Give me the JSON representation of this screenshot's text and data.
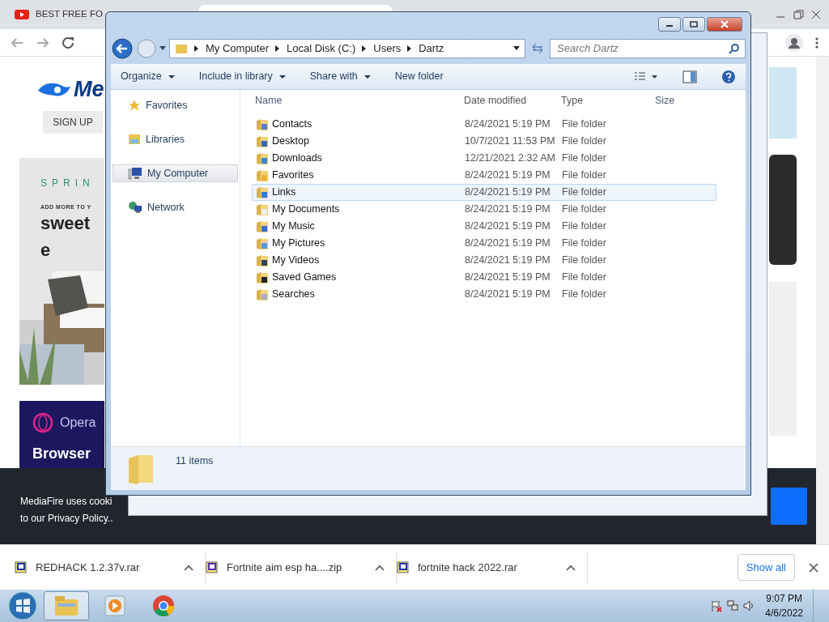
{
  "browser": {
    "tab_title": "BEST FREE FO",
    "page": {
      "logo_text": "Me",
      "sign_up": "SIGN UP",
      "ad_spring": "SPRIN",
      "ad_tagline": "ADD MORE TO Y",
      "ad_headline": "sweet e",
      "ad_brand": "Opera",
      "ad_title": "Browser",
      "cookie_lines": [
        "MediaFire uses cooki",
        "to our Privacy Policy.."
      ]
    }
  },
  "explorer": {
    "breadcrumb": [
      "My Computer",
      "Local Disk (C:)",
      "Users",
      "Dartz"
    ],
    "search": {
      "placeholder": "Search Dartz"
    },
    "toolbar": [
      {
        "label": "Organize",
        "dropdown": true
      },
      {
        "label": "Include in library",
        "dropdown": true
      },
      {
        "label": "Share with",
        "dropdown": true
      },
      {
        "label": "New folder",
        "dropdown": false
      }
    ],
    "nav": [
      {
        "label": "Favorites",
        "kind": "star",
        "selected": false
      },
      {
        "label": "Libraries",
        "kind": "library",
        "selected": false
      },
      {
        "label": "My Computer",
        "kind": "computer",
        "selected": true
      },
      {
        "label": "Network",
        "kind": "network",
        "selected": false
      }
    ],
    "columns": [
      "Name",
      "Date modified",
      "Type",
      "Size"
    ],
    "files": [
      {
        "name": "Contacts",
        "date": "8/24/2021 5:19 PM",
        "type": "File folder",
        "hovered": false
      },
      {
        "name": "Desktop",
        "date": "10/7/2021 11:53 PM",
        "type": "File folder",
        "hovered": false
      },
      {
        "name": "Downloads",
        "date": "12/21/2021 2:32 AM",
        "type": "File folder",
        "hovered": false
      },
      {
        "name": "Favorites",
        "date": "8/24/2021 5:19 PM",
        "type": "File folder",
        "hovered": false
      },
      {
        "name": "Links",
        "date": "8/24/2021 5:19 PM",
        "type": "File folder",
        "hovered": true
      },
      {
        "name": "My Documents",
        "date": "8/24/2021 5:19 PM",
        "type": "File folder",
        "hovered": false
      },
      {
        "name": "My Music",
        "date": "8/24/2021 5:19 PM",
        "type": "File folder",
        "hovered": false
      },
      {
        "name": "My Pictures",
        "date": "8/24/2021 5:19 PM",
        "type": "File folder",
        "hovered": false
      },
      {
        "name": "My Videos",
        "date": "8/24/2021 5:19 PM",
        "type": "File folder",
        "hovered": false
      },
      {
        "name": "Saved Games",
        "date": "8/24/2021 5:19 PM",
        "type": "File folder",
        "hovered": false
      },
      {
        "name": "Searches",
        "date": "8/24/2021 5:19 PM",
        "type": "File folder",
        "hovered": false
      }
    ],
    "status": "11 items"
  },
  "downloads": {
    "items": [
      {
        "name": "REDHACK 1.2.37v.rar",
        "kind": "rar"
      },
      {
        "name": "Fortnite aim esp ha....zip",
        "kind": "zip"
      },
      {
        "name": "fortnite hack 2022.rar",
        "kind": "rar"
      }
    ],
    "show_all": "Show all"
  },
  "taskbar": {
    "apps": [
      {
        "kind": "explorer",
        "selected": true
      },
      {
        "kind": "media",
        "selected": false
      },
      {
        "kind": "chrome",
        "selected": false
      }
    ],
    "time": "9:07 PM",
    "date": "4/6/2022"
  }
}
